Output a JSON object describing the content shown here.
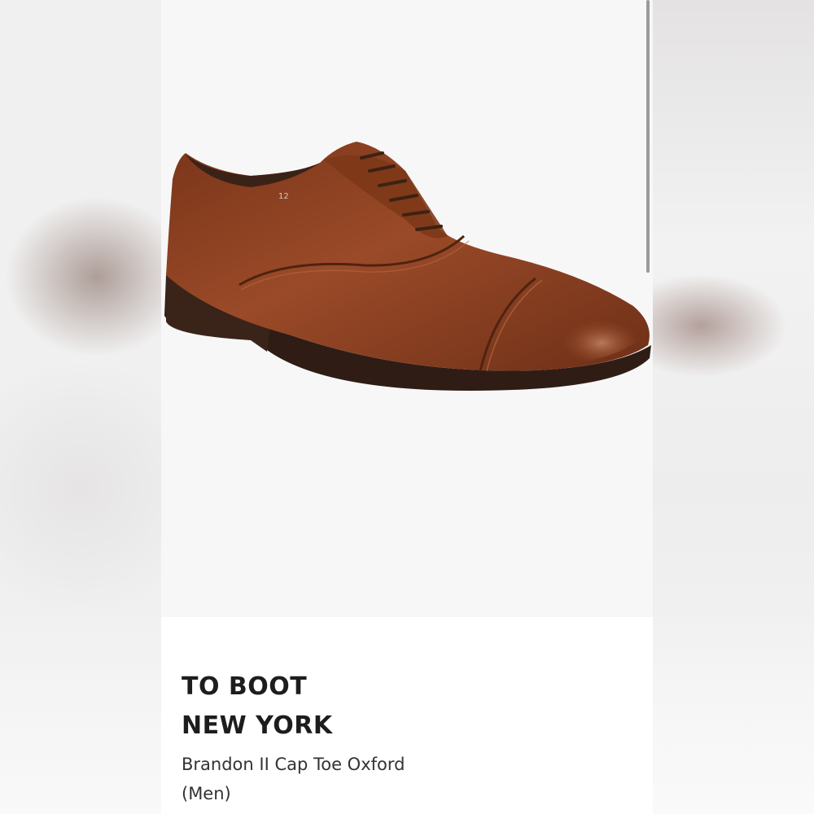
{
  "product": {
    "brand_line1": "TO BOOT",
    "brand_line2": "NEW YORK",
    "name_line1": "Brandon II Cap Toe Oxford",
    "name_line2": "(Men)"
  },
  "image": {
    "subject": "brown-leather-cap-toe-oxford-shoe-icon",
    "insole_mark": "12"
  },
  "colors": {
    "leather": "#8a3f22",
    "sole": "#2f1d15",
    "background": "#f7f7f7",
    "text": "#1d1d1d"
  }
}
